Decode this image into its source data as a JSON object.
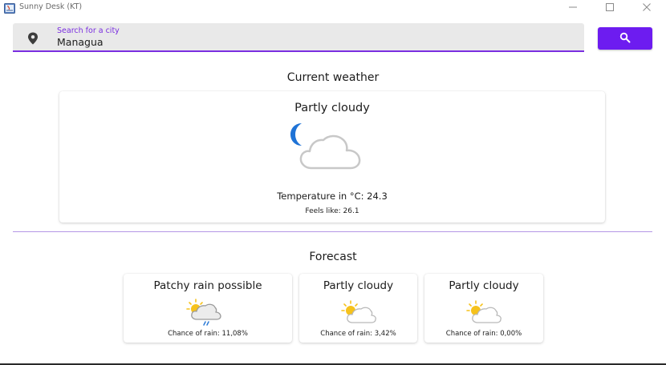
{
  "window": {
    "title": "Sunny Desk (KT)",
    "controls": {
      "minimize": "—",
      "maximize": "☐",
      "close": "✕"
    }
  },
  "search": {
    "label": "Search for a city",
    "value": "Managua",
    "icon": "map-pin-icon",
    "button_icon": "search-icon",
    "accent": "#6d1cf0"
  },
  "current": {
    "section_title": "Current weather",
    "condition": "Partly cloudy",
    "icon": "partly-cloudy-night-icon",
    "temperature_text": "Temperature in °C: 24.3",
    "feels_like_text": "Feels like: 26.1"
  },
  "forecast": {
    "section_title": "Forecast",
    "days": [
      {
        "condition": "Patchy rain possible",
        "rain": "Chance of rain: 11,08%",
        "icon": "patchy-rain-icon"
      },
      {
        "condition": "Partly cloudy",
        "rain": "Chance of rain: 3,42%",
        "icon": "partly-cloudy-day-icon"
      },
      {
        "condition": "Partly cloudy",
        "rain": "Chance of rain: 0,00%",
        "icon": "partly-cloudy-day-icon"
      }
    ]
  },
  "colors": {
    "accent": "#7a2ee0",
    "moon": "#1f73d6",
    "sun": "#f6c21c",
    "rain": "#2b7ad6"
  }
}
